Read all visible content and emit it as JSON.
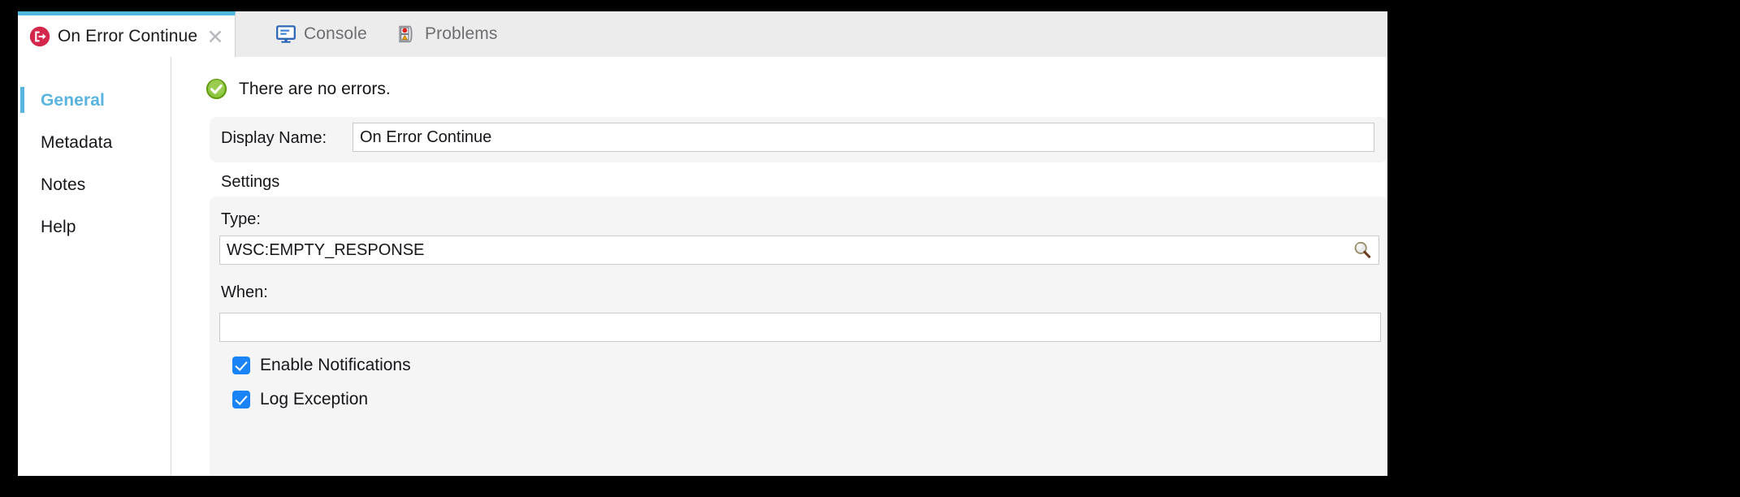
{
  "window": {
    "title": "On Error Continue"
  },
  "tabs": [
    {
      "id": "on-error-continue",
      "label": "On Error Continue",
      "icon": "error-exit-icon",
      "active": true,
      "closable": true
    },
    {
      "id": "console",
      "label": "Console",
      "icon": "console-monitor-icon",
      "active": false,
      "closable": false
    },
    {
      "id": "problems",
      "label": "Problems",
      "icon": "problems-page-icon",
      "active": false,
      "closable": false
    }
  ],
  "sidebar": {
    "items": [
      {
        "label": "General",
        "selected": true
      },
      {
        "label": "Metadata",
        "selected": false
      },
      {
        "label": "Notes",
        "selected": false
      },
      {
        "label": "Help",
        "selected": false
      }
    ]
  },
  "main": {
    "status": {
      "icon": "success-check-icon",
      "text": "There are no errors."
    },
    "display_name": {
      "label": "Display Name:",
      "value": "On Error Continue",
      "placeholder": ""
    },
    "settings": {
      "heading": "Settings",
      "type": {
        "label": "Type:",
        "value": "WSC:EMPTY_RESPONSE",
        "placeholder": "",
        "search_icon": "magnifier-icon"
      },
      "when": {
        "label": "When:",
        "value": "",
        "placeholder": ""
      },
      "checkboxes": [
        {
          "label": "Enable Notifications",
          "checked": true
        },
        {
          "label": "Log Exception",
          "checked": true
        }
      ]
    }
  },
  "colors": {
    "accent_tab": "#4fb8de",
    "selected_item": "#5ab4e0",
    "checkbox": "#1a84f7",
    "error_icon": "#d3274b",
    "success_icon": "#7cb921",
    "tabbar_bg": "#ececed",
    "card_bg": "#f5f5f6"
  }
}
